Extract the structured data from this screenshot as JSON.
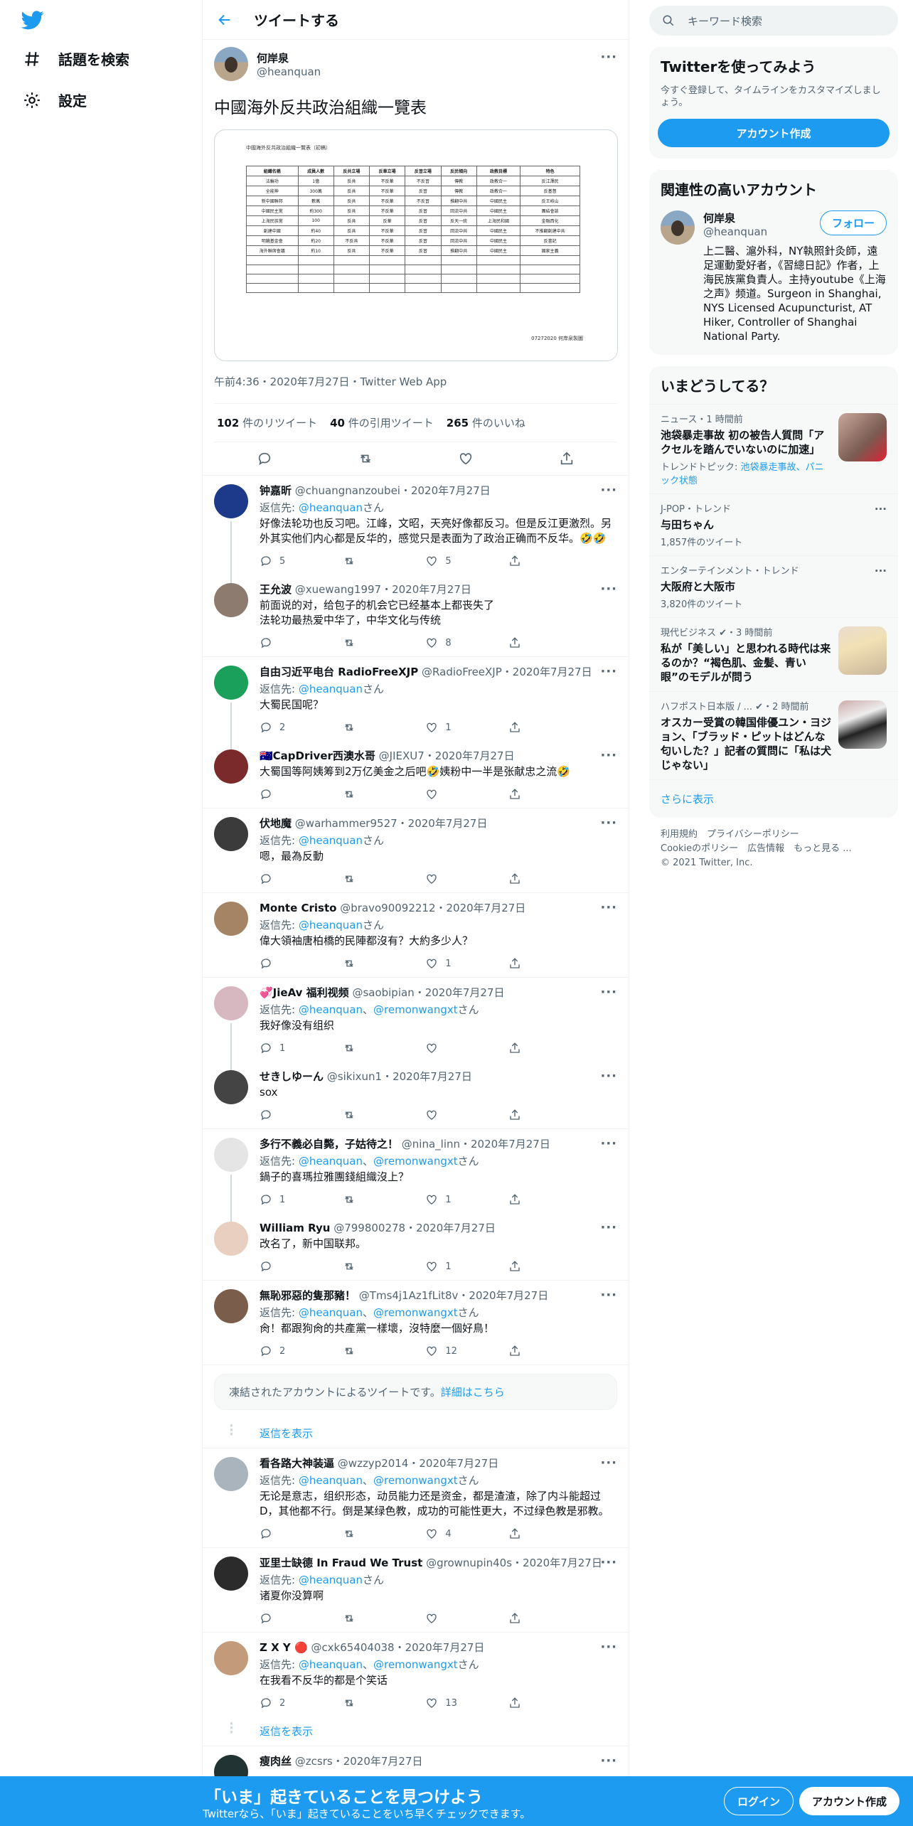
{
  "nav": {
    "explore": "話題を検索",
    "settings": "設定"
  },
  "header": {
    "title": "ツイートする"
  },
  "main_tweet": {
    "name": "何岸泉",
    "handle": "@heanquan",
    "text": "中國海外反共政治組織一覽表",
    "image_caption": "中國海外反共政治組織一覽表（初稿）",
    "image_footer": "07272020 何岸泉製圖",
    "table_headers": [
      "組織名稱",
      "成員人數",
      "反共立場",
      "反華立場",
      "反習立場",
      "反民傾向",
      "政教目標",
      "特色"
    ],
    "table_rows": [
      [
        "法輪功",
        "1億",
        "反共",
        "不反華",
        "不反習",
        "傳教",
        "政教合一",
        "反江澤民"
      ],
      [
        "全能神",
        "300萬",
        "反共",
        "不反華",
        "反習",
        "傳教",
        "政教合一",
        "反基督"
      ],
      [
        "新中國聯邦",
        "數萬",
        "反共",
        "不反華",
        "不反習",
        "推翻中共",
        "中國民主",
        "反王岐山"
      ],
      [
        "中國民主黨",
        "約300",
        "反共",
        "不反華",
        "反習",
        "回流中共",
        "中國民主",
        "團結會談"
      ],
      [
        "上海民族黨",
        "100",
        "反共",
        "反華",
        "反習",
        "反天一統",
        "上海民和國",
        "金融西化"
      ],
      [
        "創建中國",
        "約40",
        "反共",
        "不反華",
        "反習",
        "回流中共",
        "中國民主",
        "不推翻創建中共"
      ],
      [
        "明鏡基金會",
        "約20",
        "不反共",
        "不反華",
        "反習",
        "回流中共",
        "中國民主",
        "反書記"
      ],
      [
        "海外聯席會議",
        "約10",
        "反共",
        "不反華",
        "反習",
        "推翻中共",
        "中國民主",
        "國家主義"
      ]
    ],
    "time": "午前4:36・2020年7月27日・Twitter Web App",
    "retweets_num": "102",
    "retweets_label": "件のリツイート",
    "quotes_num": "40",
    "quotes_label": "件の引用ツイート",
    "likes_num": "265",
    "likes_label": "件のいいね"
  },
  "replies": [
    {
      "name": "钟嘉昕",
      "handle": "@chuangnanzoubei・2020年7月27日",
      "to_label": "返信先: ",
      "to": "@heanquan",
      "to_suffix": "さん",
      "text": "好像法轮功也反习吧。江峰，文昭，天亮好像都反习。但是反江更激烈。另外其实他们内心都是反华的，感觉只是表面为了政治正确而不反华。🤣🤣",
      "reply_count": "5",
      "retweet_count": "",
      "like_count": "5"
    },
    {
      "name": "王允波",
      "handle": "@xuewang1997・2020年7月27日",
      "text": "前面说的对，给包子的机会它已经基本上都丧失了\n法轮功最热爱中华了，中华文化与传统",
      "reply_count": "",
      "retweet_count": "",
      "like_count": "8"
    },
    {
      "name": "自由习近平电台 RadioFreeXJP",
      "handle": "@RadioFreeXJP・2020年7月27日",
      "to_label": "返信先: ",
      "to": "@heanquan",
      "to_suffix": "さん",
      "text": "大蜀民国呢？",
      "reply_count": "2",
      "retweet_count": "",
      "like_count": "1"
    },
    {
      "name": "🇦🇺CapDriver西澳水哥",
      "handle": "@JIEXU7・2020年7月27日",
      "text": "大蜀国等阿姨筹到2万亿美金之后吧🤣姨粉中一半是张献忠之流🤣",
      "reply_count": "",
      "retweet_count": "",
      "like_count": ""
    },
    {
      "name": "伏地魔",
      "handle": "@warhammer9527・2020年7月27日",
      "to_label": "返信先: ",
      "to": "@heanquan",
      "to_suffix": "さん",
      "text": "嗯，最為反動",
      "reply_count": "",
      "retweet_count": "",
      "like_count": ""
    },
    {
      "name": "Monte Cristo",
      "handle": "@bravo90092212・2020年7月27日",
      "to_label": "返信先: ",
      "to": "@heanquan",
      "to_suffix": "さん",
      "text": "偉大領袖唐柏橋的民陣都沒有？大約多少人？",
      "reply_count": "",
      "retweet_count": "",
      "like_count": "1"
    },
    {
      "name": "💞JieAv 福利视频",
      "handle": "@saobipian・2020年7月27日",
      "to_label": "返信先: ",
      "to": "@heanquan",
      "to_and": "、",
      "to2": "@remonwangxt",
      "to_suffix": "さん",
      "text": "我好像没有组织",
      "reply_count": "1",
      "retweet_count": "",
      "like_count": ""
    },
    {
      "name": "せきしゆーん",
      "handle": "@sikixun1・2020年7月27日",
      "text": "sox",
      "reply_count": "",
      "retweet_count": "",
      "like_count": ""
    },
    {
      "name": "多行不義必自斃，子姑待之！",
      "handle": "@nina_linn・2020年7月27日",
      "to_label": "返信先: ",
      "to": "@heanquan",
      "to_and": "、",
      "to2": "@remonwangxt",
      "to_suffix": "さん",
      "text": "鍋子的喜瑪拉雅團錢組織沒上？",
      "reply_count": "1",
      "retweet_count": "",
      "like_count": "1"
    },
    {
      "name": "William Ryu",
      "handle": "@799800278・2020年7月27日",
      "text": "改名了，新中国联邦。",
      "reply_count": "",
      "retweet_count": "",
      "like_count": "1"
    },
    {
      "name": "無恥邪惡的隻那豬！",
      "handle": "@Tms4j1Az1fLit8v・2020年7月27日",
      "to_label": "返信先: ",
      "to": "@heanquan",
      "to_and": "、",
      "to2": "@remonwangxt",
      "to_suffix": "さん",
      "text": "肏！都跟狗肏的共產黨一樣壞，沒特麼一個好鳥！",
      "reply_count": "2",
      "retweet_count": "",
      "like_count": "12"
    },
    {
      "name": "看各路大神装逼",
      "handle": "@wzzyp2014・2020年7月27日",
      "to_label": "返信先: ",
      "to": "@heanquan",
      "to_and": "、",
      "to2": "@remonwangxt",
      "to_suffix": "さん",
      "text": "无论是意志，组织形态，动员能力还是资金，都是渣渣，除了内斗能超过D，其他都不行。倒是某绿色教，成功的可能性更大，不过绿色教是邪教。",
      "reply_count": "",
      "retweet_count": "",
      "like_count": "4"
    },
    {
      "name": "亚里士缺德 In Fraud We Trust",
      "handle": "@grownupin40s・2020年7月27日",
      "to_label": "返信先: ",
      "to": "@heanquan",
      "to_suffix": "さん",
      "text": "诸夏你没算啊",
      "reply_count": "",
      "retweet_count": "",
      "like_count": ""
    },
    {
      "name": "Z X Y 🔴",
      "handle": "@cxk65404038・2020年7月27日",
      "to_label": "返信先: ",
      "to": "@heanquan",
      "to_and": "、",
      "to2": "@remonwangxt",
      "to_suffix": "さん",
      "text": "在我看不反华的都是个笑话",
      "reply_count": "2",
      "retweet_count": "",
      "like_count": "13"
    },
    {
      "name": "瘦肉丝",
      "handle": "@zcsrs・2020年7月27日",
      "text": "",
      "reply_count": "",
      "retweet_count": "",
      "like_count": ""
    }
  ],
  "notice": {
    "text": "凍結されたアカウントによるツイートです。",
    "link": "詳細はこちら"
  },
  "show_replies": "返信を表示",
  "right": {
    "search_placeholder": "キーワード検索",
    "signup": {
      "title": "Twitterを使ってみよう",
      "sub": "今すぐ登録して、タイムラインをカスタマイズしましょう。",
      "button": "アカウント作成"
    },
    "relevant": {
      "title": "関連性の高いアカウント",
      "name": "何岸泉",
      "handle": "@heanquan",
      "follow": "フォロー",
      "bio": "上二醫、滬外科，NY執照針灸師，遠足運動愛好者，《習總日記》作者，上海民族黨負責人。主持youtube《上海之声》频道。Surgeon in Shanghai, NYS Licensed Acupuncturist, AT Hiker, Controller of Shanghai National Party."
    },
    "trends": {
      "title": "いまどうしてる？",
      "items": [
        {
          "ctx": "ニュース・1 時間前",
          "title": "池袋暴走事故 初の被告人質問「アクセルを踏んでいないのに加速」",
          "sub_label": "トレンドトピック: ",
          "sub_link": "池袋暴走事故、パニック状態"
        },
        {
          "ctx": "J-POP・トレンド",
          "title": "与田ちゃん",
          "sub": "1,857件のツイート"
        },
        {
          "ctx": "エンターテインメント・トレンド",
          "title": "大阪府と大阪市",
          "sub": "3,820件のツイート"
        },
        {
          "ctx": "現代ビジネス ✔・3 時間前",
          "title": "私が「美しい」と思われる時代は来るのか？“褐色肌、金髪、青い眼”のモデルが問う"
        },
        {
          "ctx": "ハフポスト日本版 / ... ✔・2 時間前",
          "title": "オスカー受賞の韓国俳優ユン・ヨジョン、「ブラッド・ピットはどんな匂いした？」記者の質問に「私は犬じゃない」"
        }
      ],
      "show_more": "さらに表示"
    },
    "footer": {
      "links1": "利用規約　プライバシーポリシー",
      "links2": "Cookieのポリシー　広告情報　もっと見る ...",
      "copyright": "© 2021 Twitter, Inc."
    }
  },
  "bottombar": {
    "title": "「いま」起きていることを見つけよう",
    "sub": "Twitterなら、「いま」起きていることをいち早くチェックできます。",
    "login": "ログイン",
    "signup": "アカウント作成"
  },
  "colors": {
    "accent": "#1d9bf0",
    "text": "#0f1419",
    "muted": "#536471"
  }
}
